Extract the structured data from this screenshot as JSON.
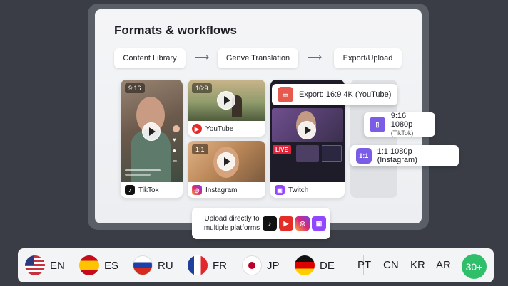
{
  "title": "Formats & workflows",
  "steps": [
    "Content Library",
    "Genve Translation",
    "Export/Upload"
  ],
  "cards": {
    "tiktok": {
      "ratio": "9:16",
      "platform": "TikTok"
    },
    "youtube": {
      "ratio": "16:9",
      "platform": "YouTube"
    },
    "instagram": {
      "ratio": "1:1",
      "platform": "Instagram"
    },
    "twitch": {
      "platform": "Twitch",
      "live": "LIVE"
    }
  },
  "exports": {
    "youtube": "Export: 16:9 4K (YouTube)",
    "tiktok_main": "9:16 1080p",
    "tiktok_sub": "(TikTok)",
    "instagram": "1:1 1080p (Instagram)"
  },
  "upload": {
    "text": "Upload directly to multiple platforms"
  },
  "languages": [
    "EN",
    "ES",
    "RU",
    "FR",
    "JP",
    "DE"
  ],
  "extra_languages": [
    "PT",
    "CN",
    "KR",
    "AR"
  ],
  "more": "30+",
  "colors": {
    "accent_purple": "#7b5ce6",
    "youtube_red": "#e52d27",
    "green": "#2fbf6a"
  }
}
